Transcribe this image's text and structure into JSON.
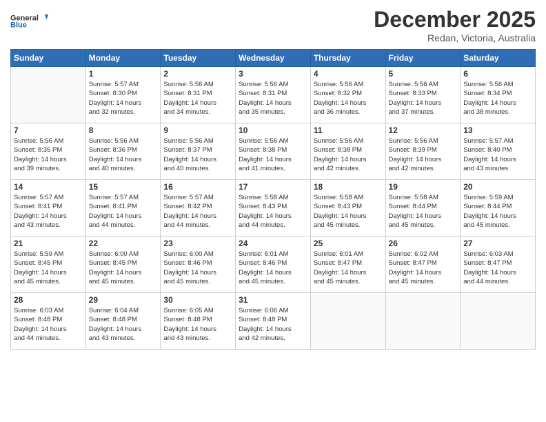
{
  "header": {
    "logo_line1": "General",
    "logo_line2": "Blue",
    "month": "December 2025",
    "location": "Redan, Victoria, Australia"
  },
  "days_of_week": [
    "Sunday",
    "Monday",
    "Tuesday",
    "Wednesday",
    "Thursday",
    "Friday",
    "Saturday"
  ],
  "weeks": [
    [
      {
        "day": "",
        "info": ""
      },
      {
        "day": "1",
        "info": "Sunrise: 5:57 AM\nSunset: 8:30 PM\nDaylight: 14 hours\nand 32 minutes."
      },
      {
        "day": "2",
        "info": "Sunrise: 5:56 AM\nSunset: 8:31 PM\nDaylight: 14 hours\nand 34 minutes."
      },
      {
        "day": "3",
        "info": "Sunrise: 5:56 AM\nSunset: 8:31 PM\nDaylight: 14 hours\nand 35 minutes."
      },
      {
        "day": "4",
        "info": "Sunrise: 5:56 AM\nSunset: 8:32 PM\nDaylight: 14 hours\nand 36 minutes."
      },
      {
        "day": "5",
        "info": "Sunrise: 5:56 AM\nSunset: 8:33 PM\nDaylight: 14 hours\nand 37 minutes."
      },
      {
        "day": "6",
        "info": "Sunrise: 5:56 AM\nSunset: 8:34 PM\nDaylight: 14 hours\nand 38 minutes."
      }
    ],
    [
      {
        "day": "7",
        "info": "Sunrise: 5:56 AM\nSunset: 8:35 PM\nDaylight: 14 hours\nand 39 minutes."
      },
      {
        "day": "8",
        "info": "Sunrise: 5:56 AM\nSunset: 8:36 PM\nDaylight: 14 hours\nand 40 minutes."
      },
      {
        "day": "9",
        "info": "Sunrise: 5:56 AM\nSunset: 8:37 PM\nDaylight: 14 hours\nand 40 minutes."
      },
      {
        "day": "10",
        "info": "Sunrise: 5:56 AM\nSunset: 8:38 PM\nDaylight: 14 hours\nand 41 minutes."
      },
      {
        "day": "11",
        "info": "Sunrise: 5:56 AM\nSunset: 8:38 PM\nDaylight: 14 hours\nand 42 minutes."
      },
      {
        "day": "12",
        "info": "Sunrise: 5:56 AM\nSunset: 8:39 PM\nDaylight: 14 hours\nand 42 minutes."
      },
      {
        "day": "13",
        "info": "Sunrise: 5:57 AM\nSunset: 8:40 PM\nDaylight: 14 hours\nand 43 minutes."
      }
    ],
    [
      {
        "day": "14",
        "info": "Sunrise: 5:57 AM\nSunset: 8:41 PM\nDaylight: 14 hours\nand 43 minutes."
      },
      {
        "day": "15",
        "info": "Sunrise: 5:57 AM\nSunset: 8:41 PM\nDaylight: 14 hours\nand 44 minutes."
      },
      {
        "day": "16",
        "info": "Sunrise: 5:57 AM\nSunset: 8:42 PM\nDaylight: 14 hours\nand 44 minutes."
      },
      {
        "day": "17",
        "info": "Sunrise: 5:58 AM\nSunset: 8:43 PM\nDaylight: 14 hours\nand 44 minutes."
      },
      {
        "day": "18",
        "info": "Sunrise: 5:58 AM\nSunset: 8:43 PM\nDaylight: 14 hours\nand 45 minutes."
      },
      {
        "day": "19",
        "info": "Sunrise: 5:58 AM\nSunset: 8:44 PM\nDaylight: 14 hours\nand 45 minutes."
      },
      {
        "day": "20",
        "info": "Sunrise: 5:59 AM\nSunset: 8:44 PM\nDaylight: 14 hours\nand 45 minutes."
      }
    ],
    [
      {
        "day": "21",
        "info": "Sunrise: 5:59 AM\nSunset: 8:45 PM\nDaylight: 14 hours\nand 45 minutes."
      },
      {
        "day": "22",
        "info": "Sunrise: 6:00 AM\nSunset: 8:45 PM\nDaylight: 14 hours\nand 45 minutes."
      },
      {
        "day": "23",
        "info": "Sunrise: 6:00 AM\nSunset: 8:46 PM\nDaylight: 14 hours\nand 45 minutes."
      },
      {
        "day": "24",
        "info": "Sunrise: 6:01 AM\nSunset: 8:46 PM\nDaylight: 14 hours\nand 45 minutes."
      },
      {
        "day": "25",
        "info": "Sunrise: 6:01 AM\nSunset: 8:47 PM\nDaylight: 14 hours\nand 45 minutes."
      },
      {
        "day": "26",
        "info": "Sunrise: 6:02 AM\nSunset: 8:47 PM\nDaylight: 14 hours\nand 45 minutes."
      },
      {
        "day": "27",
        "info": "Sunrise: 6:03 AM\nSunset: 8:47 PM\nDaylight: 14 hours\nand 44 minutes."
      }
    ],
    [
      {
        "day": "28",
        "info": "Sunrise: 6:03 AM\nSunset: 8:48 PM\nDaylight: 14 hours\nand 44 minutes."
      },
      {
        "day": "29",
        "info": "Sunrise: 6:04 AM\nSunset: 8:48 PM\nDaylight: 14 hours\nand 43 minutes."
      },
      {
        "day": "30",
        "info": "Sunrise: 6:05 AM\nSunset: 8:48 PM\nDaylight: 14 hours\nand 43 minutes."
      },
      {
        "day": "31",
        "info": "Sunrise: 6:06 AM\nSunset: 8:48 PM\nDaylight: 14 hours\nand 42 minutes."
      },
      {
        "day": "",
        "info": ""
      },
      {
        "day": "",
        "info": ""
      },
      {
        "day": "",
        "info": ""
      }
    ]
  ]
}
